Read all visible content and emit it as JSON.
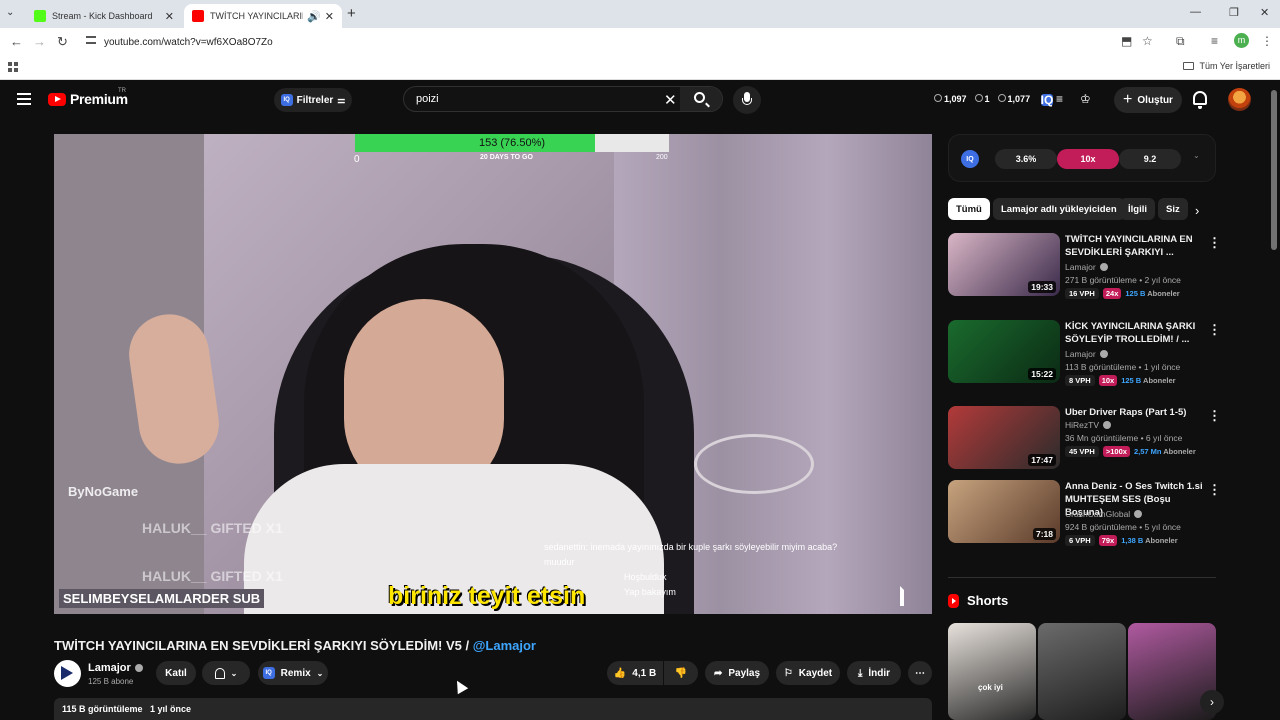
{
  "browser": {
    "tabs": [
      {
        "title": "Stream - Kick Dashboard",
        "favicon_color": "#53fc18"
      },
      {
        "title": "TWİTCH YAYINCILARINA EN",
        "favicon_color": "#ff0000"
      }
    ],
    "url": "youtube.com/watch?v=wf6XOa8O7Zo",
    "bookmarks_label": "Tüm Yer İşaretleri",
    "profile_initial": "m"
  },
  "header": {
    "logo_text": "Premium",
    "logo_region": "TR",
    "filter_label": "Filtreler",
    "search_query": "poizi",
    "stats": [
      "1,097",
      "1",
      "1,077"
    ],
    "create_label": "Oluştur"
  },
  "player": {
    "goal_label": "153 (76.50%)",
    "goal_fraction": 0.765,
    "goal_min": "0",
    "goal_days": "20 DAYS TO GO",
    "goal_max": "200",
    "watermark": "ByNoGame",
    "ghost_lines": [
      "HALUK__ GIFTED X1",
      "HALUK__ GIFTED X1"
    ],
    "sub_badge": "SELIMBEYSELAMLARDER SUB",
    "caption": "biriniz teyit etsin",
    "chat": [
      "sedanettin: inemada yayınınızda bir kuple şarkı söyleyebilir miyim acaba?",
      "muudur",
      "Hoşbulduk",
      "Yap bakayım"
    ]
  },
  "video": {
    "title": "TWİTCH YAYINCILARINA EN SEVDİKLERİ ŞARKIYI SÖYLEDİM! V5 / ",
    "title_handle": "@Lamajor",
    "channel": "Lamajor",
    "subs": "125 B abone",
    "join": "Katıl",
    "remix": "Remix",
    "likes": "4,1 B",
    "share": "Paylaş",
    "save": "Kaydet",
    "download": "İndir",
    "views": "115 B görüntüleme",
    "age": "1 yıl önce"
  },
  "sidebar": {
    "stat_pills": [
      "3.6%",
      "10x",
      "9.2"
    ],
    "chips": [
      "Tümü",
      "Lamajor adlı yükleyiciden",
      "İlgili",
      "Siz"
    ],
    "recs": [
      {
        "title": "TWİTCH YAYINCILARINA EN SEVDİKLERİ ŞARKIYI ...",
        "channel": "Lamajor",
        "meta": "271 B görüntüleme • 2 yıl önce",
        "vph": "16 VPH",
        "mult": "24x",
        "subs": "125 B",
        "subs_label": "Aboneler",
        "duration": "19:33",
        "colors": [
          "#d9b6c6",
          "#3a2a4a"
        ]
      },
      {
        "title": "KİCK YAYINCILARINA ŞARKI SÖYLEYİP TROLLEDİM! / ...",
        "channel": "Lamajor",
        "meta": "113 B görüntüleme • 1 yıl önce",
        "vph": "8 VPH",
        "mult": "10x",
        "subs": "125 B",
        "subs_label": "Aboneler",
        "duration": "15:22",
        "colors": [
          "#1a6b2e",
          "#0b2a14"
        ]
      },
      {
        "title": "Uber Driver Raps (Part 1-5)",
        "channel": "HiRezTV",
        "meta": "36 Mn görüntüleme • 6 yıl önce",
        "vph": "45 VPH",
        "mult": ">100x",
        "subs": "2,57 Mn",
        "subs_label": "Aboneler",
        "duration": "17:47",
        "colors": [
          "#b33a3a",
          "#2b2b2b"
        ]
      },
      {
        "title": "Anna Deniz - O Ses Twitch 1.si MUHTEŞEM SES (Boşu Boşuna)",
        "channel": "CrashCamGlobal",
        "meta": "924 B görüntüleme • 5 yıl önce",
        "vph": "6 VPH",
        "mult": "79x",
        "subs": "1,38 B",
        "subs_label": "Aboneler",
        "duration": "7:18",
        "colors": [
          "#c7a37e",
          "#5a3a2a"
        ]
      }
    ],
    "shorts_title": "Shorts",
    "shorts": [
      {
        "caption": "çok iyi",
        "colors": [
          "#e8e2dc",
          "#2a2a2a"
        ]
      },
      {
        "caption": "",
        "colors": [
          "#6b6b6b",
          "#1e1e1e"
        ]
      },
      {
        "caption": "",
        "colors": [
          "#b05aa0",
          "#1b1b1b"
        ]
      }
    ]
  }
}
